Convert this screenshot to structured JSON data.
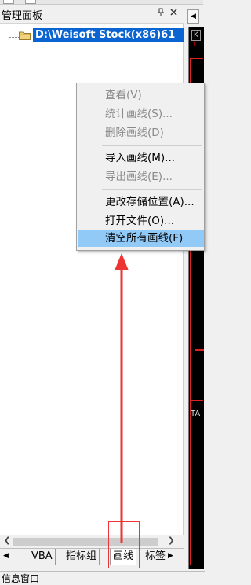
{
  "panel": {
    "title": "管理面板",
    "pin_icon": "pin-icon",
    "close_icon": "close-icon"
  },
  "tree": {
    "root_label": "D:\\Weisoft Stock(x86)61"
  },
  "context_menu": {
    "items": [
      {
        "label": "查看(V)",
        "enabled": false
      },
      {
        "label": "统计画线(S)...",
        "enabled": false
      },
      {
        "label": "删除画线(D)",
        "enabled": false
      },
      {
        "label": "导入画线(M)...",
        "enabled": true
      },
      {
        "label": "导出画线(E)...",
        "enabled": false
      },
      {
        "label": "更改存储位置(A)...",
        "enabled": true
      },
      {
        "label": "打开文件(O)...",
        "enabled": true
      },
      {
        "label": "清空所有画线(F)",
        "enabled": true,
        "highlighted": true
      }
    ]
  },
  "tabs": [
    {
      "label": "VBA"
    },
    {
      "label": "指标组"
    },
    {
      "label": "画线"
    },
    {
      "label": "标签"
    }
  ],
  "info_window": {
    "title": "信息窗口"
  },
  "right_pane": {
    "k_label": "K",
    "ta_label": "TA"
  },
  "colors": {
    "selection": "#0a64d2",
    "menu_highlight": "#91c9f7",
    "annotation": "#e33333"
  }
}
